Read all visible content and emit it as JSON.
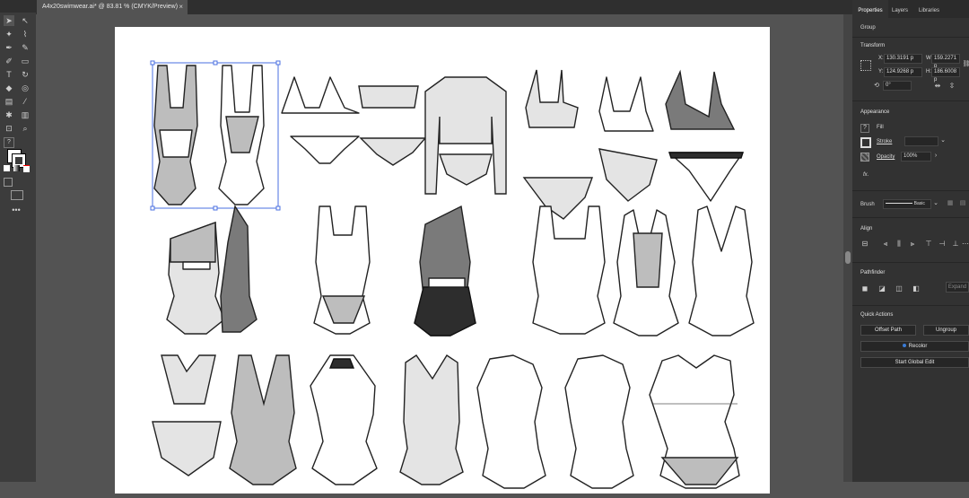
{
  "document": {
    "tab_title": "A4x20swimwear.ai* @ 83.81 % (CMYK/Preview)",
    "close_glyph": "×"
  },
  "panel": {
    "tabs": [
      "Properties",
      "Layers",
      "Libraries"
    ],
    "selection_type": "Group",
    "transform": {
      "title": "Transform",
      "x_label": "X:",
      "x": "130.3191 p",
      "y_label": "Y:",
      "y": "124.9268 p",
      "w_label": "W:",
      "w": "159.2271 p",
      "h_label": "H:",
      "h": "186.6008 p",
      "rotate": "0°"
    },
    "appearance": {
      "title": "Appearance",
      "fill_label": "Fill",
      "stroke_label": "Stroke",
      "opacity_label": "Opacity",
      "opacity": "100%",
      "fx_label": "fx."
    },
    "brush": {
      "label": "Brush",
      "value": "Basic"
    },
    "align": {
      "title": "Align"
    },
    "pathfinder": {
      "title": "Pathfinder",
      "expand": "Expand"
    },
    "quick_actions": {
      "title": "Quick Actions",
      "offset_path": "Offset Path",
      "ungroup": "Ungroup",
      "recolor": "Recolor",
      "global_edit": "Start Global Edit"
    }
  },
  "colors": {
    "accent_selection": "#4a6fe0",
    "recolor_dot": "#3a7bd5"
  },
  "icons": [
    "selection-tool-icon",
    "direct-selection-icon",
    "pen-tool-icon",
    "type-tool-icon",
    "zoom-tool-icon",
    "hand-tool-icon"
  ]
}
